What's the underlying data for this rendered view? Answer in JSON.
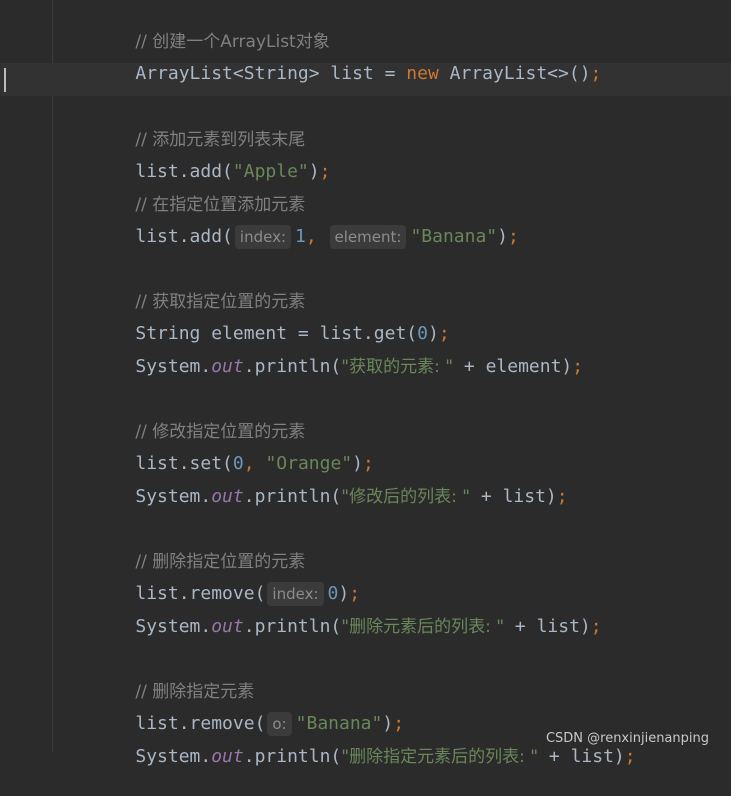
{
  "editor": {
    "lines": {
      "c1": "// 创建一个ArrayList对象",
      "l2_type": "ArrayList<String> list = ",
      "l2_new": "new",
      "l2_rest": " ArrayList<>()",
      "semi": ";",
      "c2": "// 添加元素到列表末尾",
      "add_call": "list.add(",
      "apple": "\"Apple\"",
      "close_paren": ")",
      "c3": "// 在指定位置添加元素",
      "hint_index": "index:",
      "num_1": "1",
      "comma": ",",
      "hint_element": "element:",
      "banana": "\"Banana\"",
      "c4": "// 获取指定位置的元素",
      "get_line": "String element = list.get(",
      "num_0": "0",
      "system": "System.",
      "out": "out",
      "println": ".println(",
      "str_get": "\"获取的元素: \"",
      "plus_element": " + element)",
      "c5": "// 修改指定位置的元素",
      "set_call": "list.set(",
      "orange": "\"Orange\"",
      "str_set": "\"修改后的列表: \"",
      "plus_list": " + list)",
      "c6": "// 删除指定位置的元素",
      "remove_call": "list.remove(",
      "str_remove": "\"删除元素后的列表: \"",
      "c7": "// 删除指定元素",
      "hint_o": "o:",
      "str_remove2": "\"删除指定元素后的列表: \""
    }
  },
  "watermark": "CSDN @renxinjienanping"
}
